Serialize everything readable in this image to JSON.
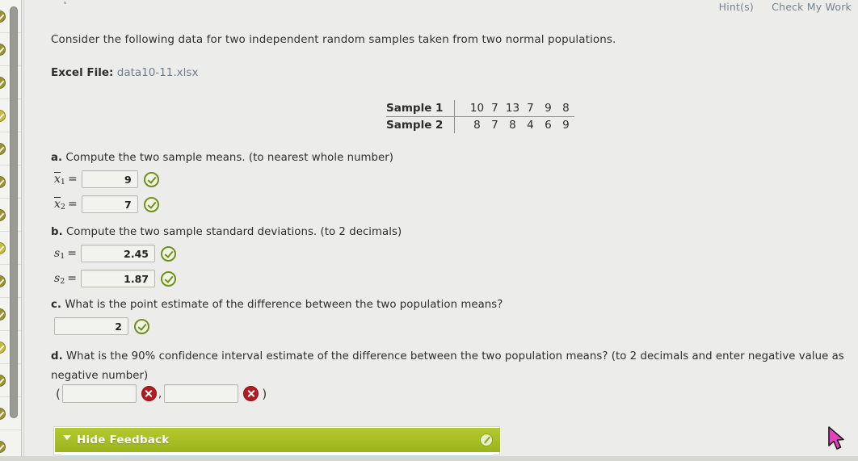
{
  "header": {
    "hint_label": "Hint(s)",
    "check_my_work_label": "Check My Work"
  },
  "prompt": "Consider the following data for two independent random samples taken from two normal populations.",
  "excel": {
    "label": "Excel File:",
    "filename": "data10-11.xlsx"
  },
  "data_table": {
    "rows": [
      {
        "label": "Sample 1",
        "values": [
          "10",
          "7",
          "13",
          "7",
          "9",
          "8"
        ]
      },
      {
        "label": "Sample 2",
        "values": [
          "8",
          "7",
          "8",
          "4",
          "6",
          "9"
        ]
      }
    ]
  },
  "questions": {
    "a": {
      "text": "a. Compute the two sample means. (to nearest whole number)",
      "prefix": "a.",
      "body": " Compute the two sample means. (to nearest whole number)",
      "fields": [
        {
          "var_base": "x",
          "var_sub": "1",
          "value": "9",
          "status": "correct"
        },
        {
          "var_base": "x",
          "var_sub": "2",
          "value": "7",
          "status": "correct"
        }
      ]
    },
    "b": {
      "prefix": "b.",
      "body": " Compute the two sample standard deviations. (to 2 decimals)",
      "fields": [
        {
          "var_base": "s",
          "var_sub": "1",
          "value": "2.45",
          "status": "correct"
        },
        {
          "var_base": "s",
          "var_sub": "2",
          "value": "1.87",
          "status": "correct"
        }
      ]
    },
    "c": {
      "prefix": "c.",
      "body": " What is the point estimate of the difference between the two population means?",
      "fields": [
        {
          "value": "2",
          "status": "correct"
        }
      ]
    },
    "d": {
      "prefix": "d.",
      "body": " What is the 90% confidence interval estimate of the difference between the two population means? (to 2 decimals and enter negative value as negative number)",
      "open_paren": "(",
      "close_paren": ")",
      "separator": ",",
      "fields": [
        {
          "value": "",
          "status": "incorrect"
        },
        {
          "value": "",
          "status": "incorrect"
        }
      ]
    }
  },
  "feedback": {
    "toggle_label": "Hide Feedback",
    "caret_icon": "triangle-down-icon",
    "edit_icon": "pencil-icon"
  },
  "colors": {
    "correct": "#6f8f1e",
    "incorrect": "#b01c22",
    "feedback_bar": "#a7bf23",
    "link": "#6f7c8a",
    "cursor": "#e83fc0"
  },
  "sidebar": {
    "item_count": 14,
    "status_icon": "check-circle-icon"
  }
}
